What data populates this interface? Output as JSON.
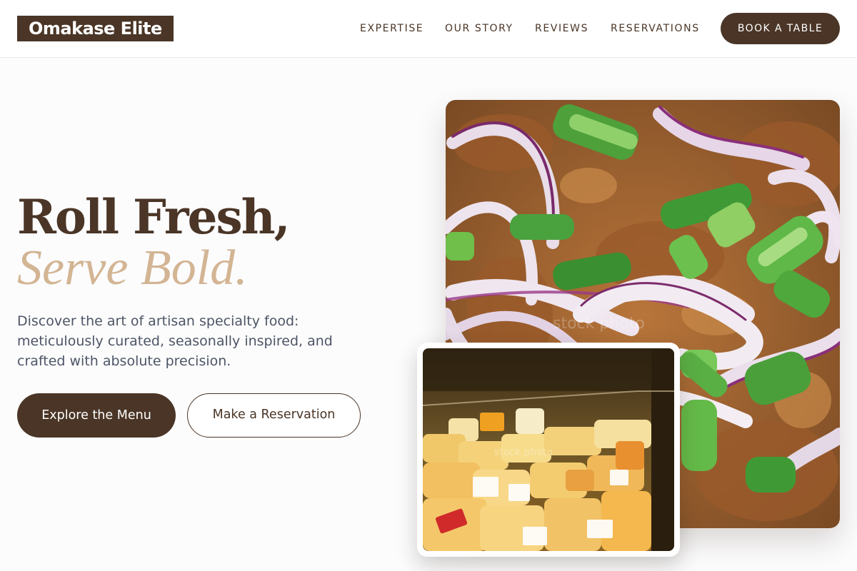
{
  "brand": {
    "name": "Omakase Elite"
  },
  "nav": {
    "items": [
      "EXPERTISE",
      "OUR STORY",
      "REVIEWS",
      "RESERVATIONS"
    ],
    "cta": "BOOK A TABLE"
  },
  "hero": {
    "title_line1": "Roll Fresh,",
    "title_line2": "Serve Bold.",
    "description": "Discover the art of artisan specialty food: meticulously curated, seasonally inspired, and crafted with absolute precision.",
    "primary_button": "Explore the Menu",
    "secondary_button": "Make a Reservation"
  },
  "images": {
    "main": "onion-scallion-food-photo",
    "secondary": "cheese-display-case-photo"
  },
  "colors": {
    "brand_brown": "#4a3526",
    "accent_tan": "#d3b594",
    "text_gray": "#4d5565"
  }
}
